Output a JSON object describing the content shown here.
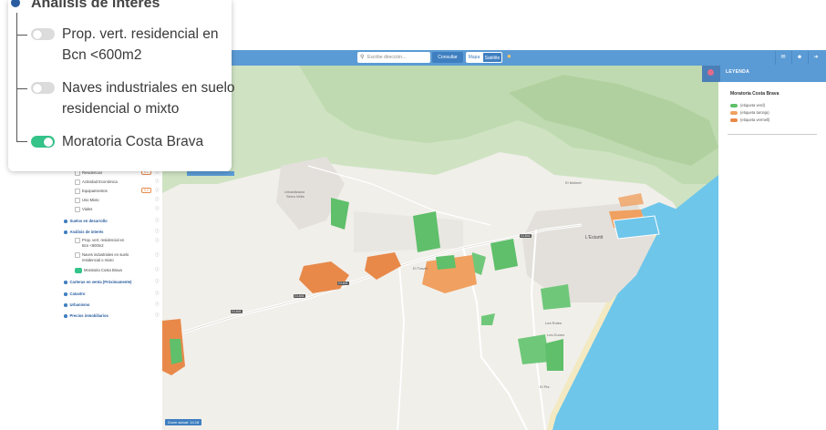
{
  "topbar": {
    "search_placeholder": "Escribe dirección...",
    "consultar_label": "Consultar",
    "mapa_label": "Mapa",
    "satelite_label": "Satélite"
  },
  "legend": {
    "title": "LEYENDA",
    "section": "Moratoria Costa Brava",
    "items": [
      {
        "label": "(etiqueta verd)",
        "color": "#5fbf6a"
      },
      {
        "label": "(etiqueta taronja)",
        "color": "#f0a060"
      },
      {
        "label": "(etiqueta vermell)",
        "color": "#e8894a"
      }
    ]
  },
  "card": {
    "title": "Análisis de interés",
    "items": [
      {
        "line1": "Prop. vert. residencial en",
        "line2": "Bcn <600m2",
        "on": false
      },
      {
        "line1": "Naves industriales en suelo",
        "line2": "residencial o mixto",
        "on": false
      },
      {
        "line1": "Moratoria Costa Brava",
        "line2": "",
        "on": true
      }
    ]
  },
  "sidebar": {
    "items": [
      {
        "label": "Residencial",
        "badge": "5 C"
      },
      {
        "label": "Actividad Económica"
      },
      {
        "label": "Equipamientos",
        "badge": "5 C"
      },
      {
        "label": "Uso Mixto"
      },
      {
        "label": "Viales"
      }
    ],
    "sections": {
      "suelos": "Suelos en desarrollo",
      "analisis": "Análisis de interés",
      "sub1a": "Prop. vert. residencial en",
      "sub1b": "Bcn <600m2",
      "sub2a": "Naves industriales en suelo",
      "sub2b": "residencial o mixto",
      "sub3": "Moratoria Costa Brava",
      "carteras": "Carteras en venta (Próximamente)",
      "catastro": "Catastro",
      "urbanismo": "Urbanismo",
      "precios": "Precios inmobiliarios"
    }
  },
  "map": {
    "labels": {
      "urbanizacion": "Urbanització",
      "serra_vella": "Serra Vella",
      "el_travet": "El Travet",
      "lestartit": "L'Estartit",
      "el_molinet": "El Molinet",
      "les_rotes": "Les Rotes",
      "les_dunes": "Les Dunes",
      "el_pla": "El Pla"
    },
    "roads": [
      "GI-641",
      "GI-641",
      "GI-641",
      "GI-641"
    ],
    "zoom_label": "Zoom actual: 14.18"
  }
}
